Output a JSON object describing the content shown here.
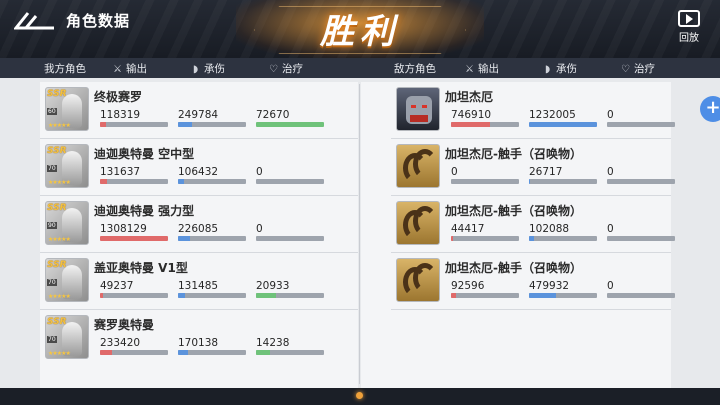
{
  "header": {
    "title": "角色数据",
    "result": "胜利",
    "replay_label": "回放"
  },
  "columns": {
    "our_team": "我方角色",
    "enemy_team": "敌方角色",
    "output": "输出",
    "damage_taken": "承伤",
    "heal": "治疗"
  },
  "colors": {
    "output": "#e06a6a",
    "damage_taken": "#5b93dc",
    "heal": "#6fc27a",
    "accent": "#f0a13a"
  },
  "our_units": [
    {
      "name": "终极赛罗",
      "rarity": "SSR",
      "level": "60",
      "output": "118319",
      "output_fill": 0.09,
      "taken": "249784",
      "taken_fill": 0.2,
      "heal": "72670",
      "heal_fill": 1.0
    },
    {
      "name": "迪迦奥特曼 空中型",
      "rarity": "SSR",
      "level": "70",
      "output": "131637",
      "output_fill": 0.1,
      "taken": "106432",
      "taken_fill": 0.09,
      "heal": "0",
      "heal_fill": 0
    },
    {
      "name": "迪迦奥特曼 强力型",
      "rarity": "SSR",
      "level": "90",
      "output": "1308129",
      "output_fill": 1.0,
      "taken": "226085",
      "taken_fill": 0.18,
      "heal": "0",
      "heal_fill": 0
    },
    {
      "name": "盖亚奥特曼 V1型",
      "rarity": "SSR",
      "level": "70",
      "output": "49237",
      "output_fill": 0.04,
      "taken": "131485",
      "taken_fill": 0.11,
      "heal": "20933",
      "heal_fill": 0.29
    },
    {
      "name": "赛罗奥特曼",
      "rarity": "SSR",
      "level": "70",
      "output": "233420",
      "output_fill": 0.18,
      "taken": "170138",
      "taken_fill": 0.14,
      "heal": "14238",
      "heal_fill": 0.2
    }
  ],
  "enemy_units": [
    {
      "name": "加坦杰厄",
      "type": "boss",
      "output": "746910",
      "output_fill": 0.57,
      "taken": "1232005",
      "taken_fill": 1.0,
      "heal": "0",
      "heal_fill": 0
    },
    {
      "name": "加坦杰厄-触手（召唤物）",
      "type": "tentacle",
      "output": "0",
      "output_fill": 0,
      "taken": "26717",
      "taken_fill": 0.02,
      "heal": "0",
      "heal_fill": 0
    },
    {
      "name": "加坦杰厄-触手（召唤物）",
      "type": "tentacle",
      "output": "44417",
      "output_fill": 0.03,
      "taken": "102088",
      "taken_fill": 0.08,
      "heal": "0",
      "heal_fill": 0
    },
    {
      "name": "加坦杰厄-触手（召唤物）",
      "type": "tentacle",
      "output": "92596",
      "output_fill": 0.07,
      "taken": "479932",
      "taken_fill": 0.39,
      "heal": "0",
      "heal_fill": 0
    }
  ]
}
